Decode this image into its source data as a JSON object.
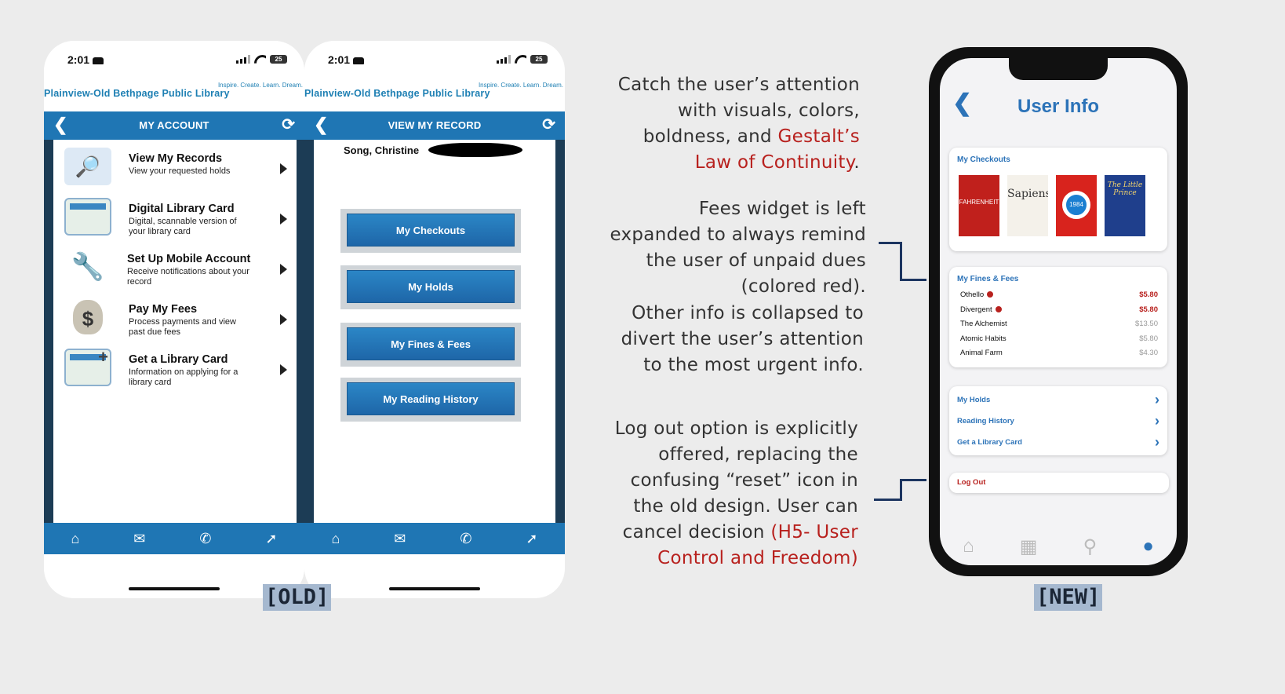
{
  "old_label": "[OLD]",
  "new_label": "[NEW]",
  "status": {
    "time": "2:01",
    "battery": "25"
  },
  "library": {
    "name": "Plainview-Old Bethpage Public Library",
    "motto": "Inspire. Create. Learn. Dream."
  },
  "old_account": {
    "title": "MY ACCOUNT",
    "items": [
      {
        "title": "View My Records",
        "subtitle": "View your requested holds",
        "icon": "magnifier-books-icon"
      },
      {
        "title": "Digital Library Card",
        "subtitle": "Digital, scannable version of your library card",
        "icon": "library-card-icon"
      },
      {
        "title": "Set Up Mobile Account",
        "subtitle": "Receive notifications about your record",
        "icon": "tools-icon"
      },
      {
        "title": "Pay My Fees",
        "subtitle": "Process payments and view past due fees",
        "icon": "money-bag-icon"
      },
      {
        "title": "Get a Library Card",
        "subtitle": "Information on applying for a library card",
        "icon": "add-card-icon"
      }
    ]
  },
  "old_record": {
    "title": "VIEW MY RECORD",
    "patron": "Song, Christine",
    "buttons": [
      "My Checkouts",
      "My Holds",
      "My Fines & Fees",
      "My Reading History"
    ]
  },
  "annotations": {
    "a1_pre": "Catch the user’s attention with visuals, colors, boldness, and ",
    "a1_red": "Gestalt’s Law of Continuity",
    "a1_post": ".",
    "a2": "Fees widget is left expanded to always remind the user of unpaid dues (colored red).",
    "a3": "Other info is collapsed to divert the user’s attention to the most urgent info.",
    "a4_pre": "Log out option is explicitly offered, replacing the confusing “reset” icon in the old design. User can cancel decision ",
    "a4_red": "(H5- User Control and Freedom)"
  },
  "new_app": {
    "title": "User Info",
    "checkouts_title": "My Checkouts",
    "covers": [
      {
        "title": "FAHRENHEIT",
        "color": "#c0201c"
      },
      {
        "title": "Sapiens",
        "color": "#f4f1ea"
      },
      {
        "title": "1984",
        "color": "#d8231d"
      },
      {
        "title": "The Little Prince",
        "color": "#1f3f8c"
      }
    ],
    "fines_title": "My Fines & Fees",
    "fines": [
      {
        "title": "Othello",
        "amount": "$5.80",
        "due": true
      },
      {
        "title": "Divergent",
        "amount": "$5.80",
        "due": true
      },
      {
        "title": "The Alchemist",
        "amount": "$13.50",
        "due": false
      },
      {
        "title": "Atomic Habits",
        "amount": "$5.80",
        "due": false
      },
      {
        "title": "Animal Farm",
        "amount": "$4.30",
        "due": false
      }
    ],
    "links": [
      "My Holds",
      "Reading History",
      "Get a Library Card"
    ],
    "logout": "Log Out"
  },
  "colors": {
    "old_blue": "#1f76b4",
    "new_blue": "#2c73b8",
    "due_red": "#b8211e"
  }
}
